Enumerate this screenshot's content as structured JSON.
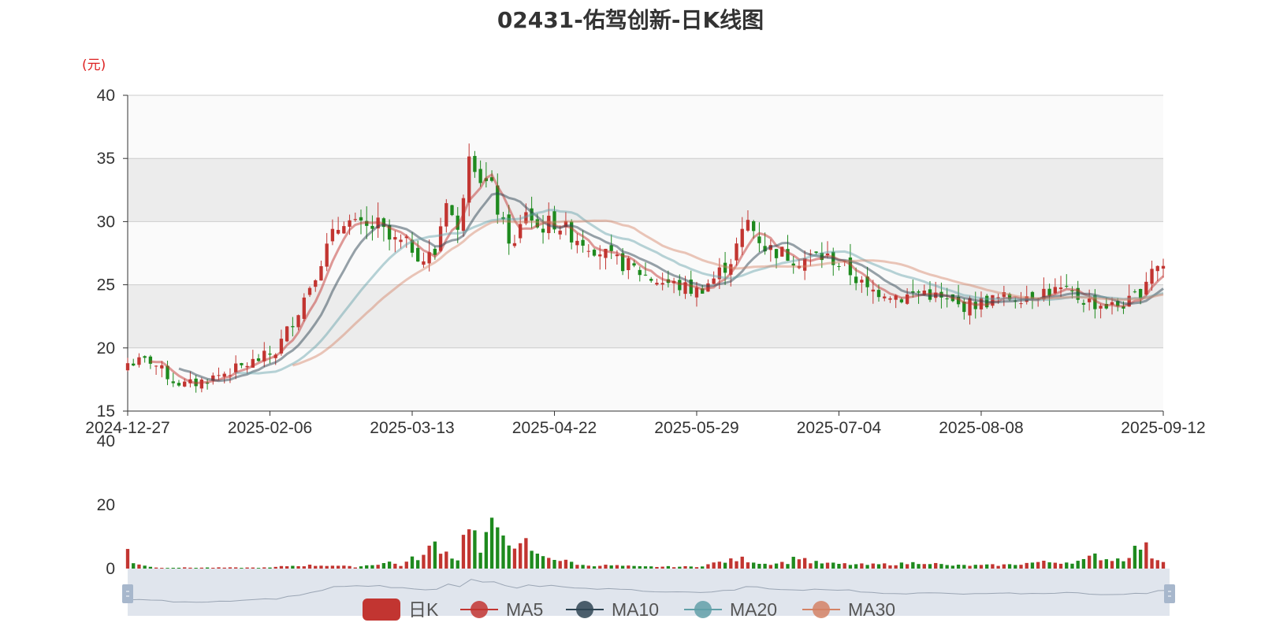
{
  "title": "02431-佑驾创新-日K线图",
  "y_unit": "(元)",
  "colors": {
    "up": "#c23531",
    "down": "#1e8a1e",
    "ma5": "#c23531",
    "ma10": "#2f4554",
    "ma20": "#61a0a8",
    "ma30": "#d48265",
    "grid": "#cccccc",
    "band_a": "#fafafa",
    "band_b": "#ececec",
    "slider_bg": "#d8dee8",
    "slider_handle": "#a7b7cc"
  },
  "legend": [
    {
      "label": "日K",
      "icon": "candlestick-legend-icon",
      "color": "#c23531"
    },
    {
      "label": "MA5",
      "icon": "line-legend-icon",
      "color": "#c23531"
    },
    {
      "label": "MA10",
      "icon": "line-legend-icon",
      "color": "#2f4554"
    },
    {
      "label": "MA20",
      "icon": "line-legend-icon",
      "color": "#61a0a8"
    },
    {
      "label": "MA30",
      "icon": "line-legend-icon",
      "color": "#d48265"
    }
  ],
  "chart_data": [
    {
      "type": "candlestick",
      "title": "02431-佑驾创新-日K线图",
      "y_unit": "(元)",
      "ylim": [
        15,
        40
      ],
      "y_ticks": [
        15,
        20,
        25,
        30,
        35,
        40
      ],
      "x_tick_labels": [
        "2024-12-27",
        "2025-02-06",
        "2025-03-13",
        "2025-04-22",
        "2025-05-29",
        "2025-07-04",
        "2025-08-08",
        "2025-09-12"
      ],
      "x_tick_positions": [
        0,
        25,
        50,
        75,
        100,
        125,
        150,
        182
      ],
      "n_days": 183,
      "anchors_close": [
        [
          0,
          18.8
        ],
        [
          4,
          19.0
        ],
        [
          8,
          17.4
        ],
        [
          10,
          17.1
        ],
        [
          12,
          17.2
        ],
        [
          20,
          18.5
        ],
        [
          26,
          19.7
        ],
        [
          30,
          23.0
        ],
        [
          34,
          27.0
        ],
        [
          36,
          28.8
        ],
        [
          38,
          30.3
        ],
        [
          40,
          29.6
        ],
        [
          42,
          29.4
        ],
        [
          44,
          29.7
        ],
        [
          46,
          28.5
        ],
        [
          50,
          28.0
        ],
        [
          52,
          27.0
        ],
        [
          54,
          27.5
        ],
        [
          56,
          32.0
        ],
        [
          58,
          29.0
        ],
        [
          60,
          36.0
        ],
        [
          62,
          33.5
        ],
        [
          64,
          32.5
        ],
        [
          66,
          29.5
        ],
        [
          68,
          28.0
        ],
        [
          70,
          31.0
        ],
        [
          72,
          29.5
        ],
        [
          75,
          30.0
        ],
        [
          78,
          29.0
        ],
        [
          82,
          28.0
        ],
        [
          85,
          27.0
        ],
        [
          88,
          26.5
        ],
        [
          92,
          25.5
        ],
        [
          96,
          25.0
        ],
        [
          100,
          24.5
        ],
        [
          103,
          25.5
        ],
        [
          106,
          27.0
        ],
        [
          109,
          30.0
        ],
        [
          112,
          28.0
        ],
        [
          115,
          27.5
        ],
        [
          118,
          27.0
        ],
        [
          121,
          27.3
        ],
        [
          124,
          27.0
        ],
        [
          127,
          26.0
        ],
        [
          130,
          24.5
        ],
        [
          133,
          24.5
        ],
        [
          136,
          24.0
        ],
        [
          140,
          24.5
        ],
        [
          143,
          23.8
        ],
        [
          146,
          23.3
        ],
        [
          149,
          23.5
        ],
        [
          152,
          23.8
        ],
        [
          155,
          24.0
        ],
        [
          158,
          24.2
        ],
        [
          161,
          24.5
        ],
        [
          164,
          24.5
        ],
        [
          167,
          24.0
        ],
        [
          170,
          23.5
        ],
        [
          173,
          23.3
        ],
        [
          176,
          23.6
        ],
        [
          178,
          24.5
        ],
        [
          180,
          26.5
        ],
        [
          182,
          26.5
        ]
      ],
      "volume": {
        "ylim": [
          0,
          40
        ],
        "y_ticks": [
          0,
          20,
          40
        ],
        "anchors": [
          [
            0,
            6
          ],
          [
            1,
            2
          ],
          [
            3,
            1
          ],
          [
            5,
            0.3
          ],
          [
            25,
            0.3
          ],
          [
            28,
            0.8
          ],
          [
            32,
            1
          ],
          [
            36,
            1
          ],
          [
            40,
            0.5
          ],
          [
            44,
            1.5
          ],
          [
            46,
            2
          ],
          [
            48,
            1
          ],
          [
            50,
            3
          ],
          [
            52,
            4
          ],
          [
            54,
            8
          ],
          [
            56,
            5
          ],
          [
            58,
            3
          ],
          [
            60,
            16
          ],
          [
            62,
            5
          ],
          [
            64,
            13
          ],
          [
            66,
            14
          ],
          [
            68,
            5
          ],
          [
            70,
            8
          ],
          [
            72,
            4
          ],
          [
            74,
            4
          ],
          [
            76,
            2.5
          ],
          [
            78,
            2
          ],
          [
            80,
            1
          ],
          [
            85,
            1
          ],
          [
            90,
            0.6
          ],
          [
            100,
            0.6
          ],
          [
            104,
            2
          ],
          [
            108,
            3
          ],
          [
            112,
            1.5
          ],
          [
            116,
            2
          ],
          [
            118,
            4
          ],
          [
            120,
            2
          ],
          [
            124,
            1.5
          ],
          [
            130,
            1.2
          ],
          [
            136,
            1.5
          ],
          [
            140,
            2
          ],
          [
            144,
            1
          ],
          [
            150,
            1
          ],
          [
            155,
            1.2
          ],
          [
            160,
            2
          ],
          [
            165,
            2
          ],
          [
            168,
            2.5
          ],
          [
            170,
            4
          ],
          [
            172,
            3
          ],
          [
            175,
            3
          ],
          [
            177,
            6
          ],
          [
            178,
            7
          ],
          [
            179,
            6.5
          ],
          [
            180,
            4
          ],
          [
            181,
            3
          ],
          [
            182,
            2.5
          ]
        ]
      },
      "ma_periods": {
        "MA5": 5,
        "MA10": 10,
        "MA20": 20,
        "MA30": 30
      },
      "legend": [
        "日K",
        "MA5",
        "MA10",
        "MA20",
        "MA30"
      ]
    }
  ]
}
